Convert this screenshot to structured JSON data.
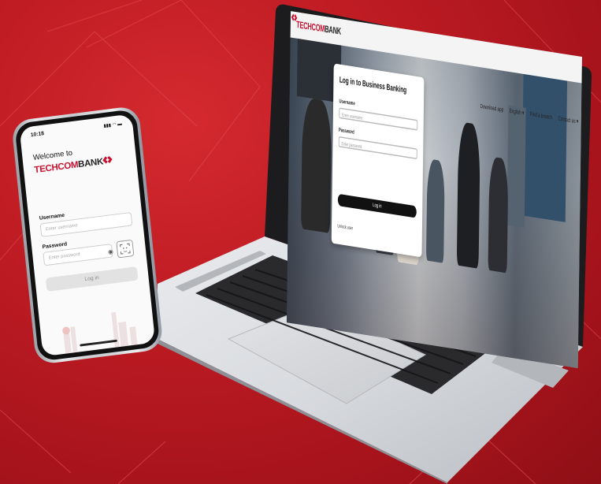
{
  "colors": {
    "background_red": "#b8141f",
    "brand_red": "#c8102e",
    "button_dark": "#111111",
    "button_disabled": "#e2e2e2"
  },
  "laptop": {
    "brand_prefix": "TECHCOM",
    "brand_suffix": "BANK",
    "nav": {
      "download": "Download app",
      "language": "English",
      "branch": "Find a branch",
      "contact": "Contact us"
    },
    "login": {
      "title": "Log in to Business Banking",
      "username_label": "Username",
      "username_placeholder": "Enter username",
      "password_label": "Password",
      "password_placeholder": "Enter password",
      "submit": "Log in",
      "unlock": "Unlock user"
    }
  },
  "phone": {
    "time": "10:18",
    "welcome": "Welcome to",
    "brand_prefix": "TECHCOM",
    "brand_suffix": "BANK",
    "username_label": "Username",
    "username_placeholder": "Enter username",
    "password_label": "Password",
    "password_placeholder": "Enter password",
    "submit": "Log in"
  }
}
